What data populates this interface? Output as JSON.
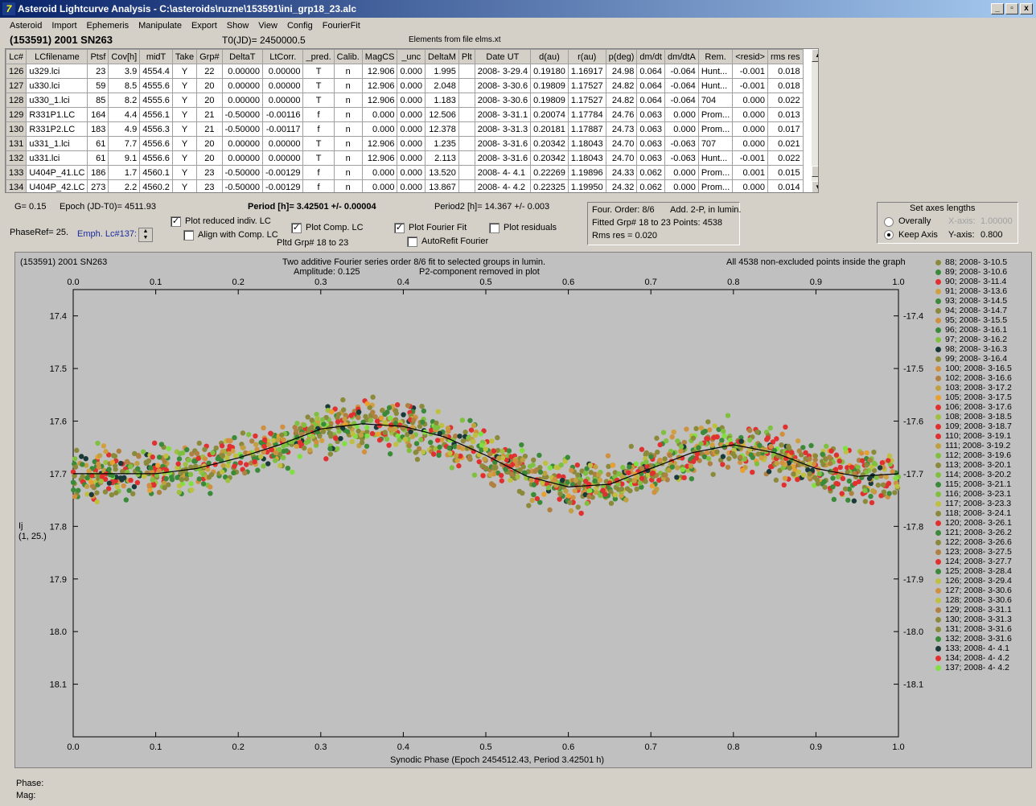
{
  "window": {
    "title": "Asteroid Lightcurve Analysis - C:\\asteroids\\ruzne\\153591\\ini_grp18_23.alc",
    "icon": "app-icon",
    "min": "_",
    "max": "▫",
    "close": "x"
  },
  "menu": [
    "Asteroid",
    "Import",
    "Ephemeris",
    "Manipulate",
    "Export",
    "Show",
    "View",
    "Config",
    "FourierFit"
  ],
  "header": {
    "asteroid": "(153591) 2001 SN263",
    "t0": "T0(JD)= 2450000.5",
    "elements": "Elements from file elms.xt"
  },
  "table": {
    "columns": [
      "Lc#",
      "LCfilename",
      "Ptsf",
      "Cov[h]",
      "midT",
      "Take",
      "Grp#",
      "DeltaT",
      "LtCorr.",
      "_pred.",
      "Calib.",
      "MagCS",
      "_unc",
      "DeltaM",
      "Plt",
      "Date UT",
      "d(au)",
      "r(au)",
      "p(deg)",
      "dm/dt",
      "dm/dtA",
      "Rem.",
      "<resid>",
      "rms res"
    ],
    "rows": [
      [
        "126",
        "u329.lci",
        "23",
        "3.9",
        "4554.4",
        "Y",
        "22",
        "0.00000",
        "0.00000",
        "T",
        "n",
        "12.906",
        "0.000",
        "1.995",
        "",
        "2008- 3-29.4",
        "0.19180",
        "1.16917",
        "24.98",
        "0.064",
        "-0.064",
        "Hunt...",
        "-0.001",
        "0.018"
      ],
      [
        "127",
        "u330.lci",
        "59",
        "8.5",
        "4555.6",
        "Y",
        "20",
        "0.00000",
        "0.00000",
        "T",
        "n",
        "12.906",
        "0.000",
        "2.048",
        "",
        "2008- 3-30.6",
        "0.19809",
        "1.17527",
        "24.82",
        "0.064",
        "-0.064",
        "Hunt...",
        "-0.001",
        "0.018"
      ],
      [
        "128",
        "u330_1.lci",
        "85",
        "8.2",
        "4555.6",
        "Y",
        "20",
        "0.00000",
        "0.00000",
        "T",
        "n",
        "12.906",
        "0.000",
        "1.183",
        "",
        "2008- 3-30.6",
        "0.19809",
        "1.17527",
        "24.82",
        "0.064",
        "-0.064",
        "704",
        "0.000",
        "0.022"
      ],
      [
        "129",
        "R331P1.LC",
        "164",
        "4.4",
        "4556.1",
        "Y",
        "21",
        "-0.50000",
        "-0.00116",
        "f",
        "n",
        "0.000",
        "0.000",
        "12.506",
        "",
        "2008- 3-31.1",
        "0.20074",
        "1.17784",
        "24.76",
        "0.063",
        "0.000",
        "Prom...",
        "0.000",
        "0.013"
      ],
      [
        "130",
        "R331P2.LC",
        "183",
        "4.9",
        "4556.3",
        "Y",
        "21",
        "-0.50000",
        "-0.00117",
        "f",
        "n",
        "0.000",
        "0.000",
        "12.378",
        "",
        "2008- 3-31.3",
        "0.20181",
        "1.17887",
        "24.73",
        "0.063",
        "0.000",
        "Prom...",
        "0.000",
        "0.017"
      ],
      [
        "131",
        "u331_1.lci",
        "61",
        "7.7",
        "4556.6",
        "Y",
        "20",
        "0.00000",
        "0.00000",
        "T",
        "n",
        "12.906",
        "0.000",
        "1.235",
        "",
        "2008- 3-31.6",
        "0.20342",
        "1.18043",
        "24.70",
        "0.063",
        "-0.063",
        "707",
        "0.000",
        "0.021"
      ],
      [
        "132",
        "u331.lci",
        "61",
        "9.1",
        "4556.6",
        "Y",
        "20",
        "0.00000",
        "0.00000",
        "T",
        "n",
        "12.906",
        "0.000",
        "2.113",
        "",
        "2008- 3-31.6",
        "0.20342",
        "1.18043",
        "24.70",
        "0.063",
        "-0.063",
        "Hunt...",
        "-0.001",
        "0.022"
      ],
      [
        "133",
        "U404P_41.LC",
        "186",
        "1.7",
        "4560.1",
        "Y",
        "23",
        "-0.50000",
        "-0.00129",
        "f",
        "n",
        "0.000",
        "0.000",
        "13.520",
        "",
        "2008- 4- 4.1",
        "0.22269",
        "1.19896",
        "24.33",
        "0.062",
        "0.000",
        "Prom...",
        "0.001",
        "0.015"
      ],
      [
        "134",
        "U404P_42.LC",
        "273",
        "2.2",
        "4560.2",
        "Y",
        "23",
        "-0.50000",
        "-0.00129",
        "f",
        "n",
        "0.000",
        "0.000",
        "13.867",
        "",
        "2008- 4- 4.2",
        "0.22325",
        "1.19950",
        "24.32",
        "0.062",
        "0.000",
        "Prom...",
        "0.000",
        "0.014"
      ]
    ]
  },
  "controls": {
    "g": "G= 0.15",
    "epoch": "Epoch (JD-T0)= 4511.93",
    "period": "Period [h]= 3.42501 +/- 0.00004",
    "period2": "Period2 [h]= 14.367 +/- 0.003",
    "phaseref": "PhaseRef= 25.",
    "emph": "Emph. Lc#137:",
    "plot_reduced": "Plot reduced indiv. LC",
    "align_comp": "Align with Comp. LC",
    "plot_comp": "Plot Comp. LC",
    "pltd_grp": "Pltd Grp#  18 to   23",
    "plot_fourier": "Plot Fourier Fit",
    "autorefit": "AutoRefit Fourier",
    "plot_residuals": "Plot residuals",
    "four_order": "Four. Order:  8/6",
    "add2p": "Add. 2-P, in lumin.",
    "fitted": "Fitted Grp# 18 to 23 Points: 4538",
    "rms": "Rms res      = 0.020",
    "axes_title": "Set axes lengths",
    "overally": "Overally",
    "keep_axis": "Keep Axis",
    "xaxis_lbl": "X-axis:",
    "xaxis_val": "1.00000",
    "yaxis_lbl": "Y-axis:",
    "yaxis_val": "0.800"
  },
  "chart_data": {
    "type": "scatter",
    "title": "Two additive Fourier series order 8/6 fit to selected groups in lumin.",
    "subtitle_left": "Amplitude: 0.125",
    "subtitle_right": "P2-component removed in plot",
    "corner_left": "(153591) 2001 SN263",
    "corner_right": "All 4538 non-excluded points inside the graph",
    "xlabel": "Synodic Phase (Epoch 2454512.43, Period 3.42501 h)",
    "ylabel": "Ij",
    "ylabel2": "(1, 25.)",
    "xlim": [
      0,
      1
    ],
    "ylim": [
      18.2,
      17.35
    ],
    "xticks": [
      "0.0",
      "0.1",
      "0.2",
      "0.3",
      "0.4",
      "0.5",
      "0.6",
      "0.7",
      "0.8",
      "0.9",
      "1.0"
    ],
    "yticks": [
      "17.4",
      "17.5",
      "17.6",
      "17.7",
      "17.8",
      "17.9",
      "18.0",
      "18.1"
    ],
    "fit_curve": {
      "x": [
        0,
        0.05,
        0.1,
        0.15,
        0.2,
        0.25,
        0.3,
        0.35,
        0.4,
        0.45,
        0.5,
        0.55,
        0.6,
        0.65,
        0.7,
        0.75,
        0.8,
        0.85,
        0.9,
        0.95,
        1.0
      ],
      "y": [
        17.7,
        17.7,
        17.7,
        17.69,
        17.67,
        17.645,
        17.615,
        17.605,
        17.61,
        17.63,
        17.665,
        17.705,
        17.725,
        17.72,
        17.69,
        17.66,
        17.645,
        17.66,
        17.69,
        17.705,
        17.7
      ]
    },
    "series": [
      {
        "name": "88; 2008- 3-10.5",
        "color": "#8a8a3a"
      },
      {
        "name": "89; 2008- 3-10.6",
        "color": "#3a8a3a"
      },
      {
        "name": "90; 2008- 3-11.4",
        "color": "#e03030"
      },
      {
        "name": "91; 2008- 3-13.6",
        "color": "#d0a040"
      },
      {
        "name": "93; 2008- 3-14.5",
        "color": "#3a8a3a"
      },
      {
        "name": "94; 2008- 3-14.7",
        "color": "#8a8a3a"
      },
      {
        "name": "95; 2008- 3-15.5",
        "color": "#d09040"
      },
      {
        "name": "96; 2008- 3-16.1",
        "color": "#3a8a3a"
      },
      {
        "name": "97; 2008- 3-16.2",
        "color": "#80c040"
      },
      {
        "name": "98; 2008- 3-16.3",
        "color": "#1a3a3a"
      },
      {
        "name": "99; 2008- 3-16.4",
        "color": "#8a8a3a"
      },
      {
        "name": "100; 2008- 3-16.5",
        "color": "#d09040"
      },
      {
        "name": "102; 2008- 3-16.6",
        "color": "#b08040"
      },
      {
        "name": "103; 2008- 3-17.2",
        "color": "#c0a040"
      },
      {
        "name": "105; 2008- 3-17.5",
        "color": "#e8a030"
      },
      {
        "name": "106; 2008- 3-17.6",
        "color": "#e03030"
      },
      {
        "name": "108; 2008- 3-18.5",
        "color": "#a0c040"
      },
      {
        "name": "109; 2008- 3-18.7",
        "color": "#e03030"
      },
      {
        "name": "110; 2008- 3-19.1",
        "color": "#e03030"
      },
      {
        "name": "111; 2008- 3-19.2",
        "color": "#c0a040"
      },
      {
        "name": "112; 2008- 3-19.6",
        "color": "#80c040"
      },
      {
        "name": "113; 2008- 3-20.1",
        "color": "#8a8a3a"
      },
      {
        "name": "114; 2008- 3-20.2",
        "color": "#80c040"
      },
      {
        "name": "115; 2008- 3-21.1",
        "color": "#3a8a3a"
      },
      {
        "name": "116; 2008- 3-23.1",
        "color": "#80c040"
      },
      {
        "name": "117; 2008- 3-23.3",
        "color": "#c0c040"
      },
      {
        "name": "118; 2008- 3-24.1",
        "color": "#8a8a3a"
      },
      {
        "name": "120; 2008- 3-26.1",
        "color": "#e03030"
      },
      {
        "name": "121; 2008- 3-26.2",
        "color": "#3a8a3a"
      },
      {
        "name": "122; 2008- 3-26.6",
        "color": "#8a8a3a"
      },
      {
        "name": "123; 2008- 3-27.5",
        "color": "#b08040"
      },
      {
        "name": "124; 2008- 3-27.7",
        "color": "#e03030"
      },
      {
        "name": "125; 2008- 3-28.4",
        "color": "#3a8a3a"
      },
      {
        "name": "126; 2008- 3-29.4",
        "color": "#c0c040"
      },
      {
        "name": "127; 2008- 3-30.6",
        "color": "#d09040"
      },
      {
        "name": "128; 2008- 3-30.6",
        "color": "#c0c040"
      },
      {
        "name": "129; 2008- 3-31.1",
        "color": "#b08040"
      },
      {
        "name": "130; 2008- 3-31.3",
        "color": "#8a8a3a"
      },
      {
        "name": "131; 2008- 3-31.6",
        "color": "#8a8a3a"
      },
      {
        "name": "132; 2008- 3-31.6",
        "color": "#3a8a3a"
      },
      {
        "name": "133; 2008- 4- 4.1",
        "color": "#1a3a3a"
      },
      {
        "name": "134; 2008- 4- 4.2",
        "color": "#e03030"
      },
      {
        "name": "137; 2008- 4- 4.2",
        "color": "#80e040"
      }
    ]
  },
  "status": {
    "phase": "Phase:",
    "mag": "Mag:"
  }
}
